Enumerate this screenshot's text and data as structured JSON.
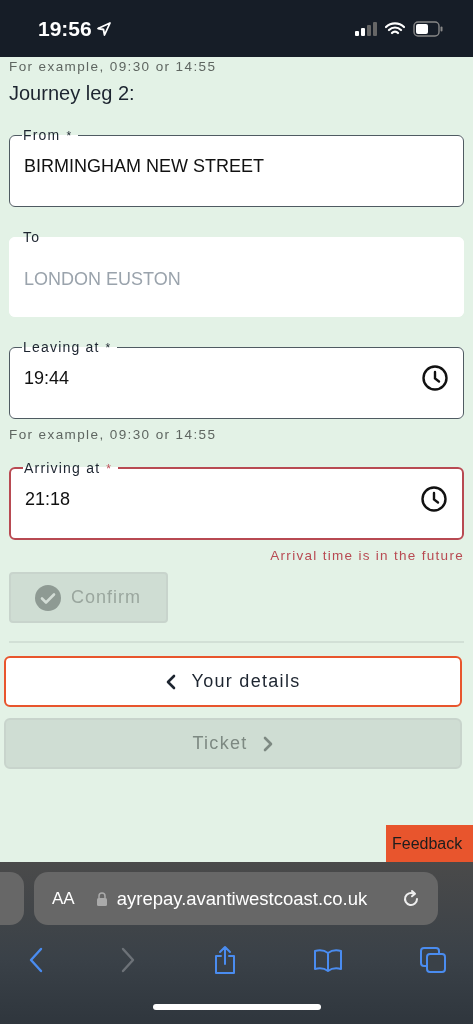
{
  "status_bar": {
    "time": "19:56",
    "location_active": true
  },
  "top_hint": "For example, 09:30 or 14:55",
  "section_title": "Journey leg 2:",
  "fields": [
    {
      "kind": "text",
      "label": "From",
      "required_marker": "*",
      "value": "BIRMINGHAM NEW STREET",
      "disabled": false,
      "error": false
    },
    {
      "kind": "text",
      "label": "To",
      "placeholder": "LONDON EUSTON",
      "disabled": true,
      "error": false
    },
    {
      "kind": "time",
      "label": "Leaving at",
      "required_marker": "*",
      "value": "19:44",
      "disabled": false,
      "error": false,
      "hint": "For example, 09:30 or 14:55"
    },
    {
      "kind": "time",
      "label": "Arriving at",
      "required_marker": "*",
      "value": "21:18",
      "disabled": false,
      "error": true,
      "error_message": "Arrival time is in the future"
    }
  ],
  "confirm_button": {
    "label": "Confirm",
    "disabled": true
  },
  "nav_buttons": [
    {
      "label": "Your details",
      "kind": "back",
      "disabled": false
    },
    {
      "label": "Ticket",
      "kind": "next",
      "disabled": true
    }
  ],
  "feedback_tab": {
    "label": "Feedback"
  },
  "browser": {
    "text_size_label": "AA",
    "url": "ayrepay.avantiwestcoast.co.uk",
    "secure": true,
    "back_enabled": true,
    "forward_enabled": false
  }
}
